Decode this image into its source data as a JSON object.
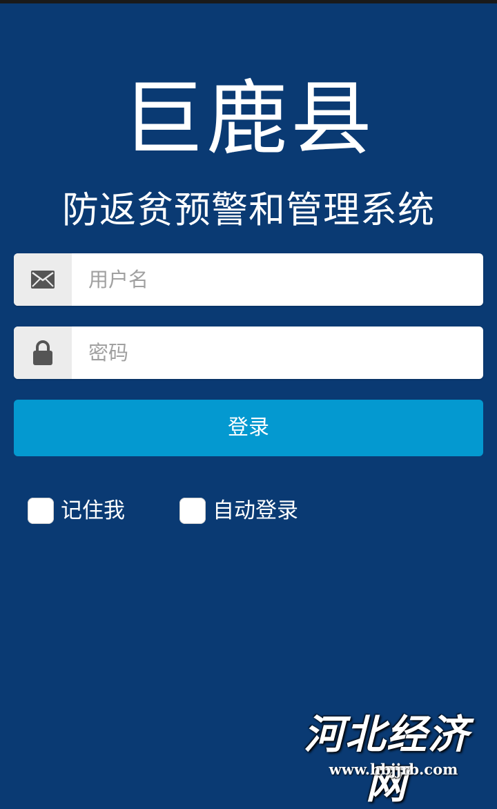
{
  "header": {
    "title": "巨鹿县",
    "subtitle": "防返贫预警和管理系统"
  },
  "form": {
    "username": {
      "placeholder": "用户名",
      "value": "",
      "icon": "envelope-icon"
    },
    "password": {
      "placeholder": "密码",
      "value": "",
      "icon": "lock-icon"
    },
    "login_label": "登录",
    "remember_label": "记住我",
    "auto_login_label": "自动登录"
  },
  "watermark": {
    "text": "河北经济网",
    "url": "www.hbjjrb.com"
  },
  "colors": {
    "background": "#0a3a73",
    "button": "#0499d0",
    "icon_box": "#ececec",
    "icon": "#555555"
  }
}
